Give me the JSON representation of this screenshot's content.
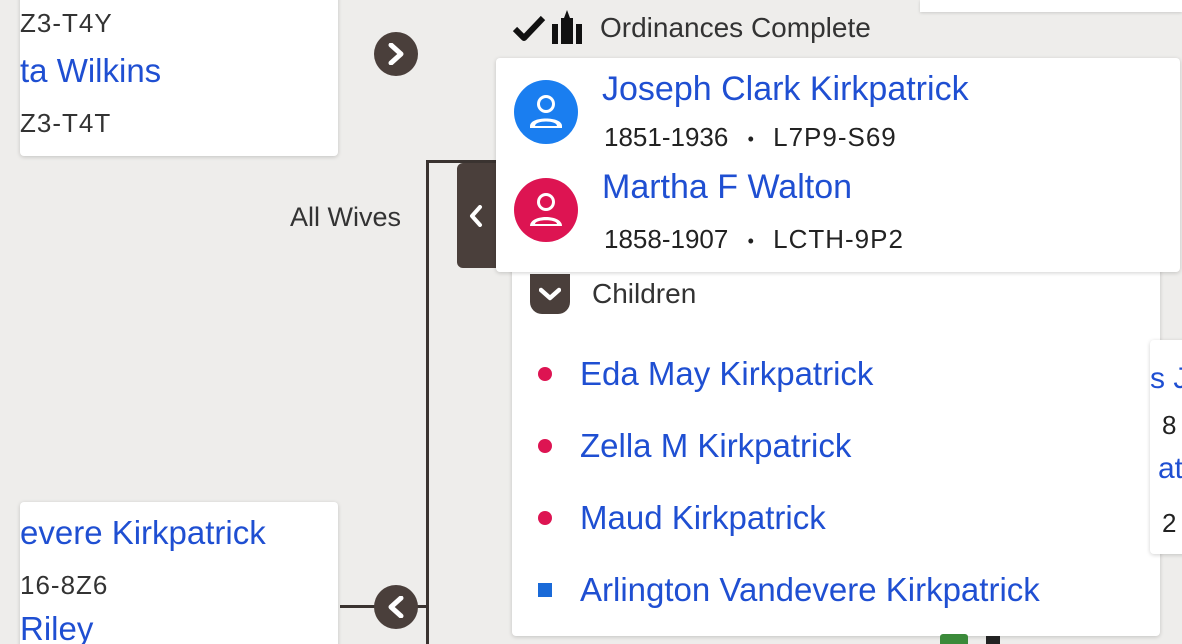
{
  "left_top_card": {
    "line1": "Z3-T4Y",
    "name": "ta Wilkins",
    "line3": "Z3-T4T"
  },
  "left_bottom_card": {
    "name": "evere Kirkpatrick",
    "line2": "16-8Z6",
    "line3": "Riley"
  },
  "ordinances": {
    "label": "Ordinances Complete"
  },
  "all_wives": {
    "label": "All Wives"
  },
  "couple": {
    "husband": {
      "name": "Joseph Clark Kirkpatrick",
      "dates": "1851-1936",
      "separator": "•",
      "id": "L7P9-S69"
    },
    "wife": {
      "name": "Martha F Walton",
      "dates": "1858-1907",
      "separator": "•",
      "id": "LCTH-9P2"
    }
  },
  "children_section": {
    "label": "Children",
    "children": [
      {
        "name": "Eda May Kirkpatrick",
        "gender": "female"
      },
      {
        "name": "Zella M Kirkpatrick",
        "gender": "female"
      },
      {
        "name": "Maud Kirkpatrick",
        "gender": "female"
      },
      {
        "name": "Arlington Vandevere Kirkpatrick",
        "gender": "male"
      }
    ]
  },
  "right_partial": {
    "line1": "s J",
    "line2": "8",
    "line3": "at",
    "line4": "2"
  },
  "colors": {
    "link_blue": "#1f4fd2",
    "male_blue": "#1a7ef0",
    "female_pink": "#dd1452",
    "dark_brown": "#4a3f3b",
    "background": "#eeedeb"
  },
  "icons": {
    "navigate_right": "chevron-right-circle-icon",
    "navigate_left": "chevron-left-circle-icon",
    "collapse": "chevron-down-icon",
    "male_person": "male-person-icon",
    "female_person": "female-person-icon",
    "checkmark": "checkmark-icon",
    "temple": "temple-icon"
  }
}
